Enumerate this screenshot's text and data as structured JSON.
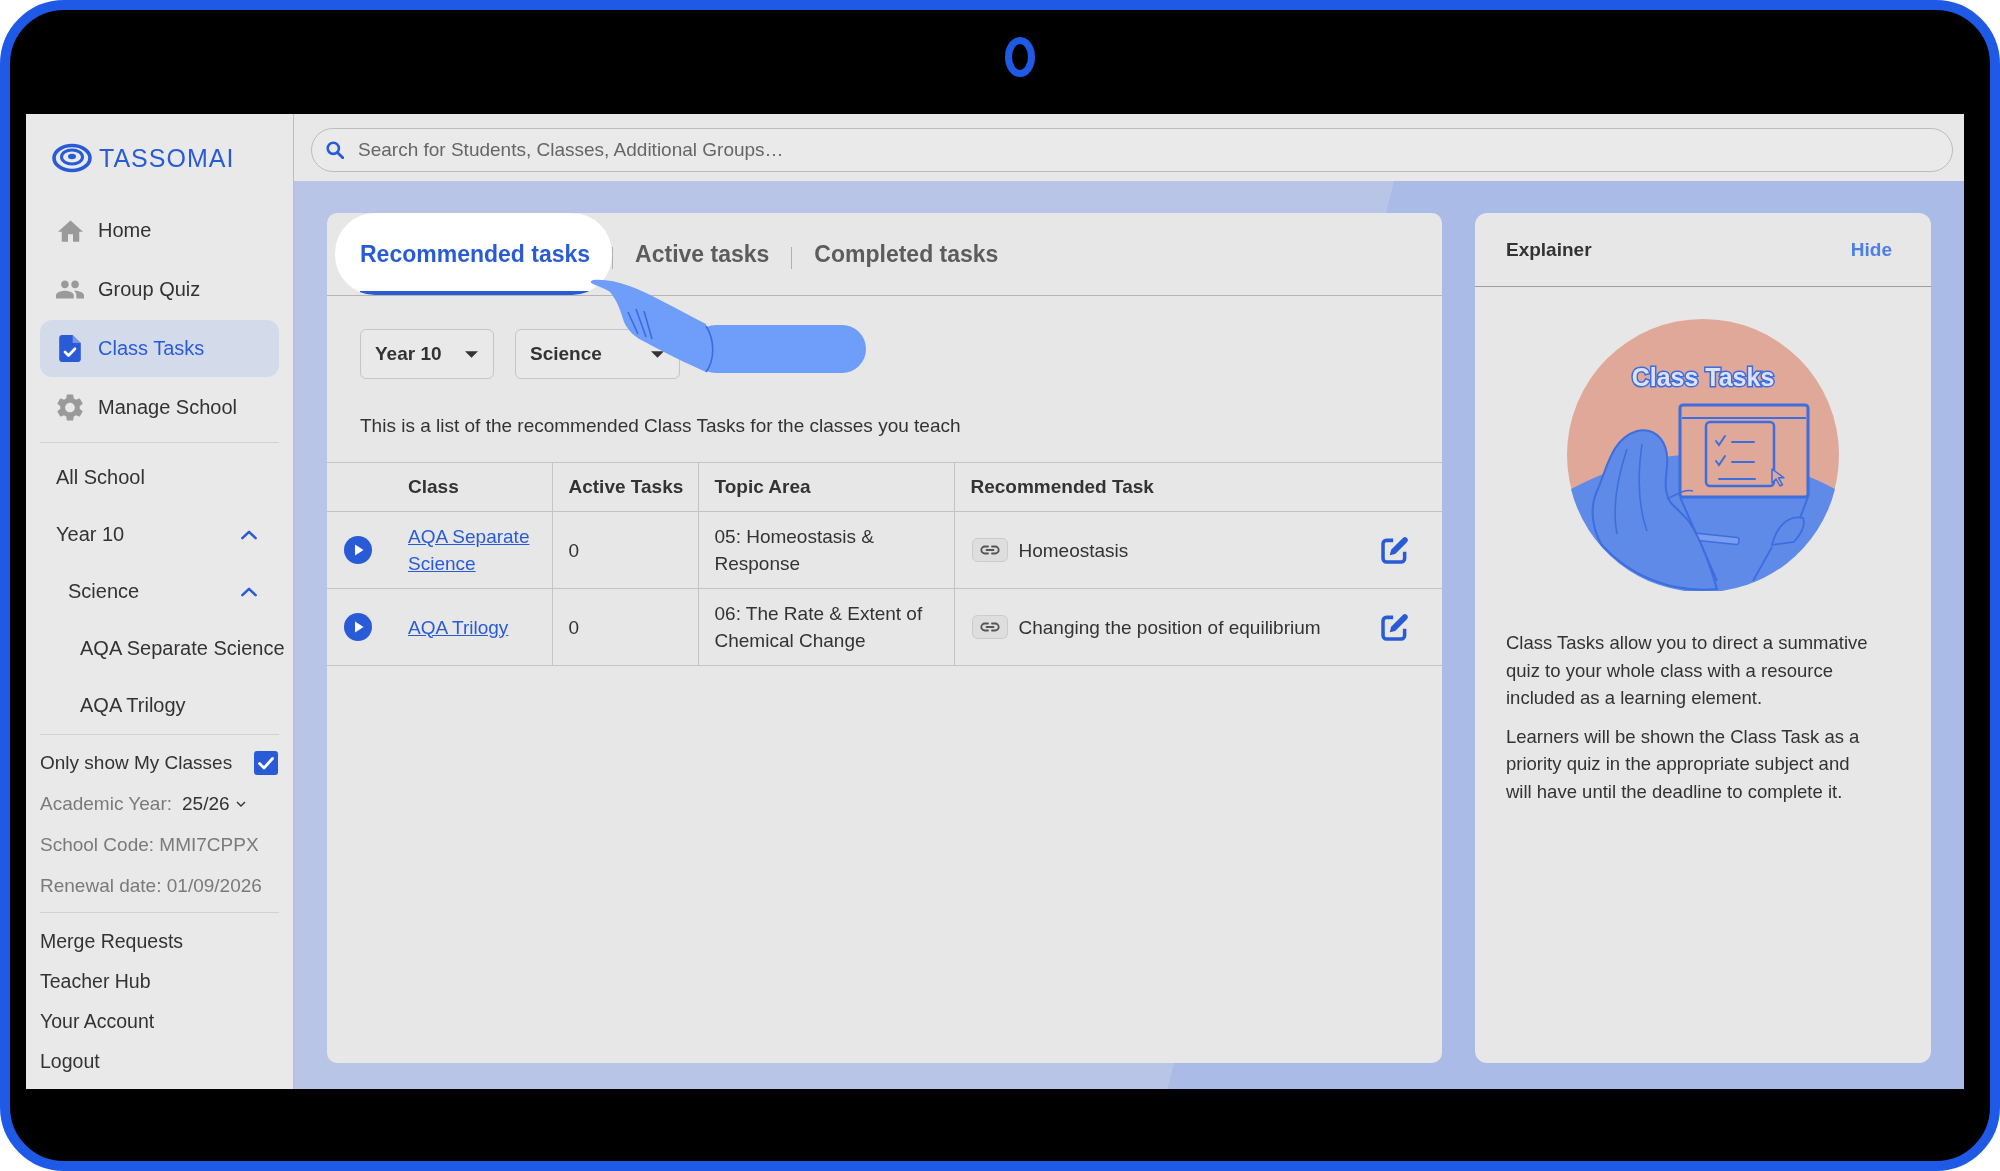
{
  "sidebar": {
    "logo": "TASSOMAI",
    "nav": [
      {
        "label": "Home",
        "selected": false
      },
      {
        "label": "Group Quiz",
        "selected": false
      },
      {
        "label": "Class Tasks",
        "selected": true
      },
      {
        "label": "Manage School",
        "selected": false
      }
    ],
    "tree": [
      {
        "label": "All School"
      },
      {
        "label": "Year 10",
        "expanded": true,
        "children": [
          {
            "label": "Science",
            "expanded": true,
            "children": [
              {
                "label": "AQA Separate Science"
              },
              {
                "label": "AQA Trilogy"
              }
            ]
          }
        ]
      }
    ],
    "my_classes": {
      "label": "Only show My Classes",
      "checked": true
    },
    "academic_year": {
      "label": "Academic Year:",
      "value": "25/26"
    },
    "school_code": "School Code: MMI7CPPX",
    "renewal_date": "Renewal date: 01/09/2026",
    "links": [
      "Merge Requests",
      "Teacher Hub",
      "Your Account",
      "Logout"
    ]
  },
  "search": {
    "placeholder": "Search for Students, Classes, Additional Groups…"
  },
  "tasks_card": {
    "tabs": [
      {
        "label": "Recommended tasks",
        "selected": true
      },
      {
        "label": "Active tasks",
        "selected": false
      },
      {
        "label": "Completed tasks",
        "selected": false
      }
    ],
    "filters": [
      "Year 10",
      "Science"
    ],
    "description": "This is a list of the recommended Class Tasks for the classes you teach",
    "table": {
      "columns": [
        "Class",
        "Active Tasks",
        "Topic Area",
        "Recommended Task"
      ],
      "rows": [
        {
          "class": "AQA Separate Science",
          "active_tasks": "0",
          "topic_area": "05: Homeostasis & Response",
          "recommended_task": "Homeostasis"
        },
        {
          "class": "AQA Trilogy",
          "active_tasks": "0",
          "topic_area": "06: The Rate & Extent of Chemical Change",
          "recommended_task": "Changing the position of equilibrium"
        }
      ]
    }
  },
  "explainer": {
    "title": "Explainer",
    "hide": "Hide",
    "illustration_title": "Class Tasks",
    "paragraphs": [
      "Class Tasks allow you to direct a summative quiz to your whole class with a resource included as a learning element.",
      "Learners will be shown the Class Task as a priority quiz in the appropriate subject and will have until the deadline to complete it."
    ]
  }
}
